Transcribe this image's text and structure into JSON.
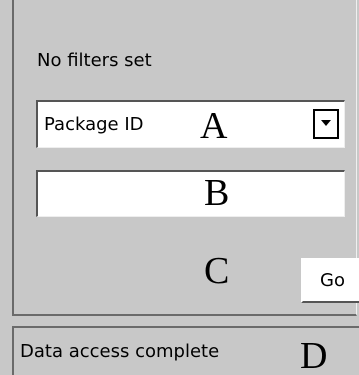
{
  "filter": {
    "status_text": "No filters set",
    "field_select": {
      "selected": "Package ID",
      "arrow_icon": "chevron-down-icon"
    },
    "value_input": {
      "value": "",
      "placeholder": ""
    },
    "go_label": "Go"
  },
  "status_bar": {
    "text": "Data access complete"
  },
  "markers": {
    "a": "A",
    "b": "B",
    "c": "C",
    "d": "D"
  }
}
